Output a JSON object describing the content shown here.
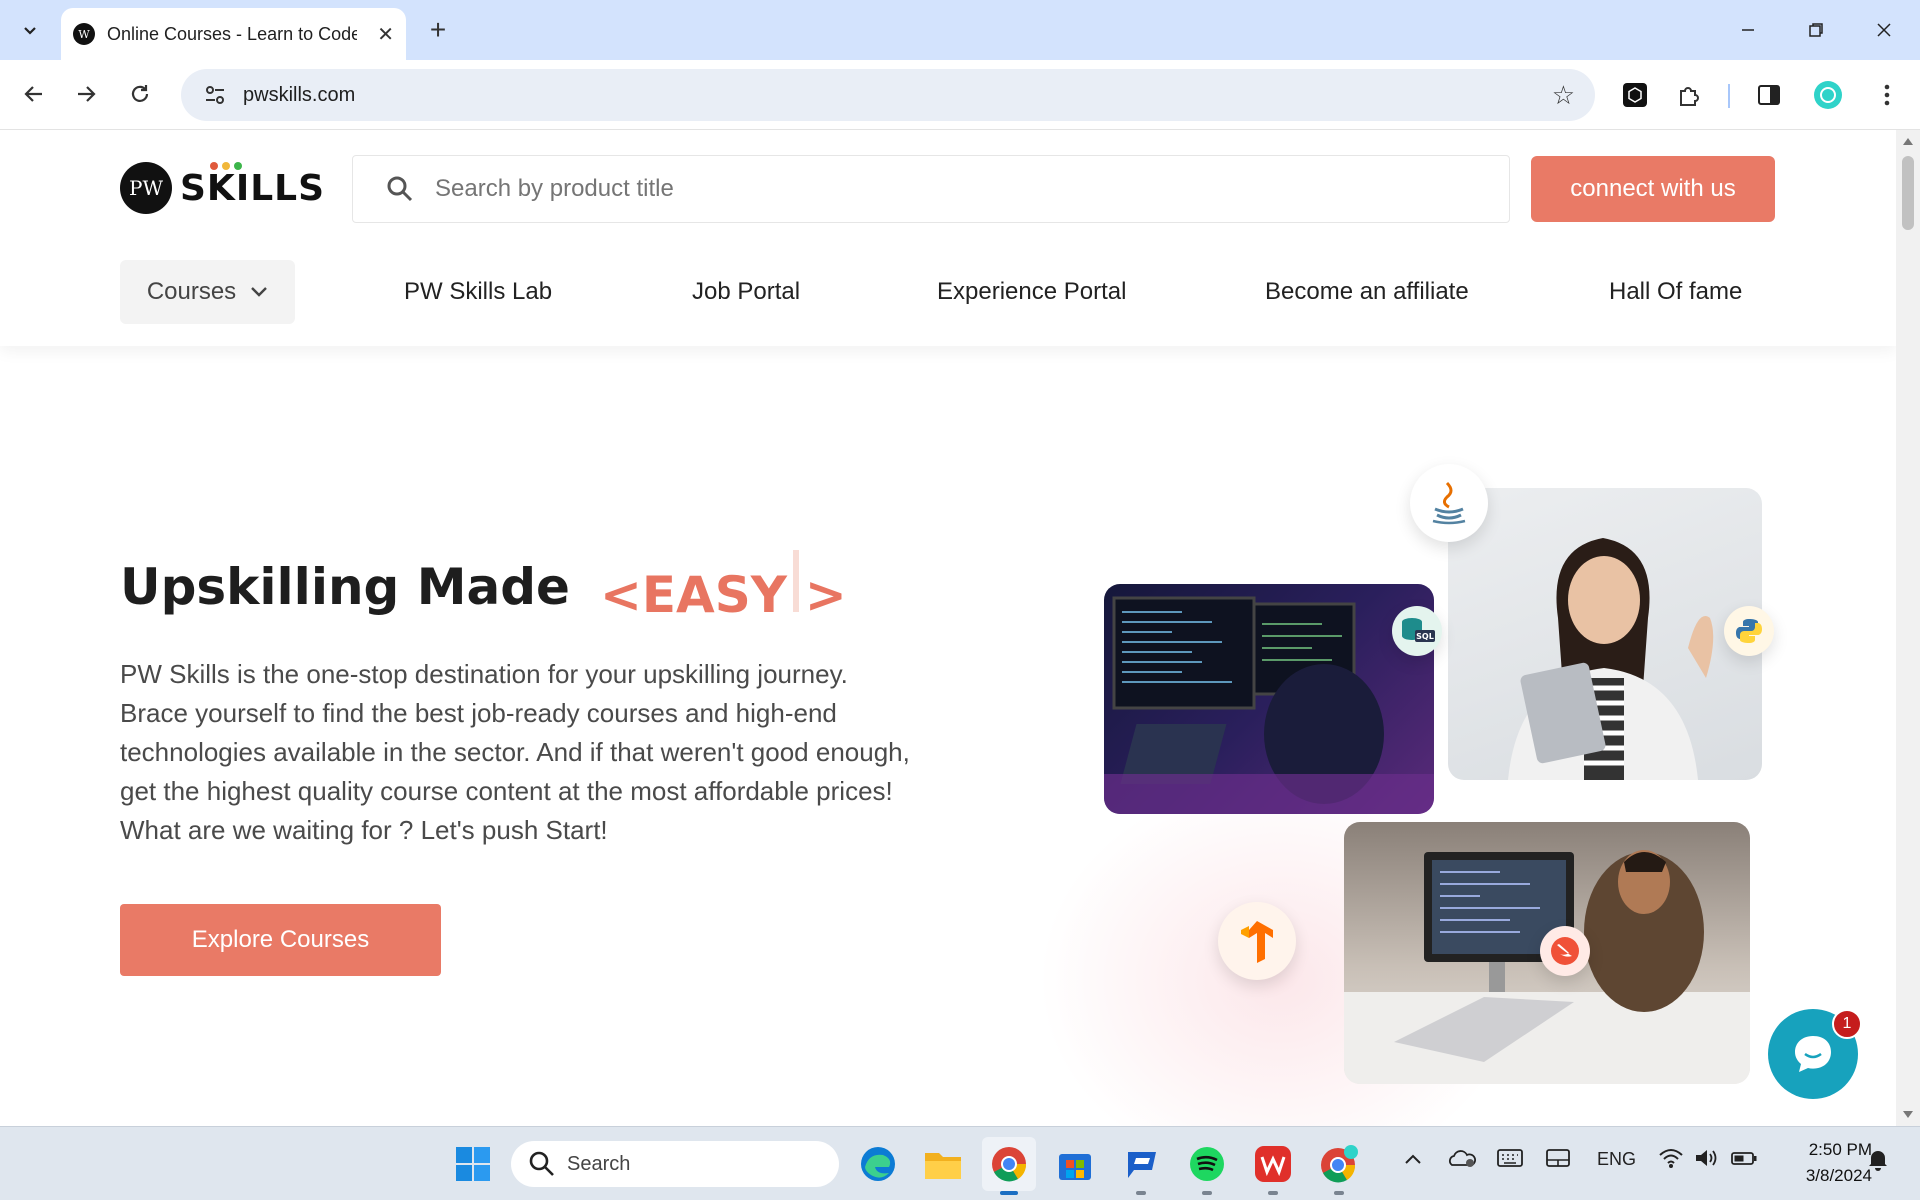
{
  "browser": {
    "tab_title": "Online Courses - Learn to Code",
    "url": "pwskills.com",
    "new_tab_symbol": "+",
    "tab_close_symbol": "✕"
  },
  "site": {
    "logo_pw": "PW",
    "logo_text": "SKILLS",
    "search_placeholder": "Search by product title",
    "connect_label": "connect with us",
    "nav": {
      "courses": "Courses",
      "items": [
        "PW Skills Lab",
        "Job Portal",
        "Experience Portal",
        "Become an affiliate",
        "Hall Of fame"
      ]
    },
    "hero": {
      "title": "Upskilling Made",
      "easy_open": "<EASY",
      "easy_close": ">",
      "description": [
        "PW Skills is the one-stop destination for your upskilling journey.",
        "Brace yourself to find the best job-ready courses and high-end",
        "technologies available in the sector. And if that weren't good enough,",
        "get the highest quality course content at the most affordable prices!",
        "What are we waiting for ? Let's push Start!"
      ],
      "cta": "Explore Courses"
    },
    "badges": {
      "sql": "SQL"
    },
    "chat_unread": "1"
  },
  "taskbar": {
    "search_label": "Search",
    "language": "ENG",
    "time": "2:50 PM",
    "date": "3/8/2024"
  },
  "colors": {
    "accent": "#e97a66",
    "easy_text": "#e87561",
    "chrome_tabstrip": "#d3e3fd",
    "chat_button": "#17a2bd"
  }
}
